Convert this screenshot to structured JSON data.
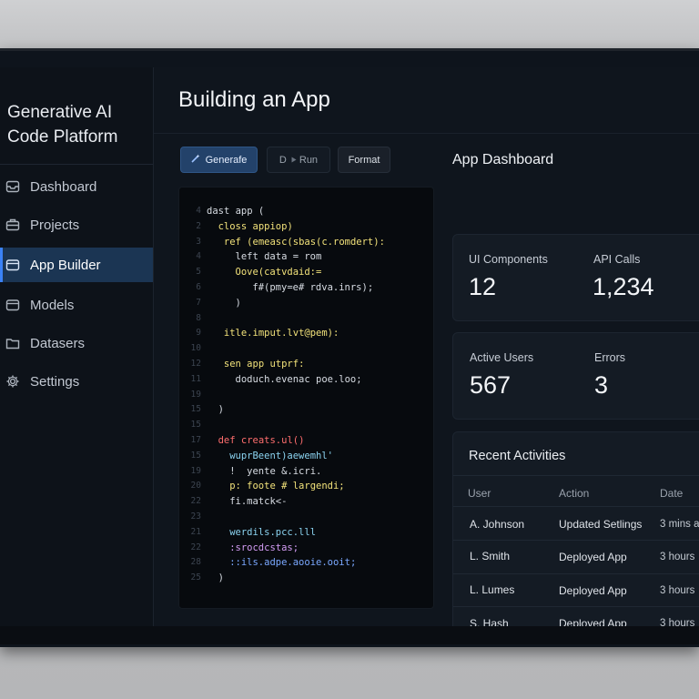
{
  "sidebar": {
    "brand_line1": "Generative AI",
    "brand_line2": "Code Platform",
    "items": [
      {
        "label": "Dashboard",
        "icon": "inbox-icon"
      },
      {
        "label": "Projects",
        "icon": "briefcase-icon"
      },
      {
        "label": "App Builder",
        "icon": "box-icon",
        "active": true
      },
      {
        "label": "Models",
        "icon": "box-icon"
      },
      {
        "label": "Datasers",
        "icon": "folder-icon"
      },
      {
        "label": "Settings",
        "icon": "gear-icon"
      }
    ]
  },
  "main": {
    "title": "Building an App",
    "toolbar": {
      "generate_label": "Generafe",
      "run_prefix": "D",
      "run_label": "Run",
      "format_label": "Format"
    },
    "editor": {
      "lines": [
        {
          "n": "4",
          "text": "dast app (",
          "color": "wht",
          "indent": 0
        },
        {
          "n": "2",
          "text": "closs appiop)",
          "color": "yel",
          "indent": 2
        },
        {
          "n": "3",
          "text": "ref (emeasc(sbas(c.romdert):",
          "color": "yel",
          "indent": 3
        },
        {
          "n": "4",
          "text": "left data = rom",
          "color": "wht",
          "indent": 5
        },
        {
          "n": "5",
          "text": "Oove(catvdaid:=",
          "color": "yel",
          "indent": 5
        },
        {
          "n": "6",
          "text": "f#(pmy=e# rdva.inrs);",
          "color": "wht",
          "indent": 8
        },
        {
          "n": "7",
          "text": ")",
          "color": "wht",
          "indent": 5
        },
        {
          "n": "8",
          "text": "",
          "color": "wht",
          "indent": 0
        },
        {
          "n": "9",
          "text": "itle.imput.lvt@pem):",
          "color": "yel",
          "indent": 3
        },
        {
          "n": "10",
          "text": "",
          "color": "wht",
          "indent": 0
        },
        {
          "n": "12",
          "text": "sen app utprf:",
          "color": "yel",
          "indent": 3
        },
        {
          "n": "11",
          "text": "doduch.evenac poe.loo;",
          "color": "wht",
          "indent": 5
        },
        {
          "n": "19",
          "text": "",
          "color": "wht",
          "indent": 0
        },
        {
          "n": "15",
          "text": ")",
          "color": "wht",
          "indent": 2
        },
        {
          "n": "15",
          "text": "",
          "color": "wht",
          "indent": 0
        },
        {
          "n": "17",
          "text": "def creats.ul()",
          "color": "red",
          "indent": 2
        },
        {
          "n": "15",
          "text": "wuprBeent)aewemhl'",
          "color": "cyn",
          "indent": 4
        },
        {
          "n": "19",
          "text": "!  yente &.icri.",
          "color": "wht",
          "indent": 4
        },
        {
          "n": "20",
          "text": "p: foote # largendi;",
          "color": "yel",
          "indent": 4
        },
        {
          "n": "22",
          "text": "fi.matck<-",
          "color": "wht",
          "indent": 4
        },
        {
          "n": "23",
          "text": "",
          "color": "wht",
          "indent": 0
        },
        {
          "n": "21",
          "text": "werdils.pcc.lll",
          "color": "cyn",
          "indent": 4
        },
        {
          "n": "22",
          "text": ":srocdcstas;",
          "color": "pur",
          "indent": 4
        },
        {
          "n": "28",
          "text": "::ils.adpe.aooie.ooit;",
          "color": "blu",
          "indent": 4
        },
        {
          "n": "25",
          "text": ")",
          "color": "wht",
          "indent": 2
        }
      ]
    },
    "dashboard": {
      "title": "App Dashboard",
      "stats": [
        {
          "label": "UI Components",
          "value": "12"
        },
        {
          "label": "API Calls",
          "value": "1,234"
        },
        {
          "label": "Active Users",
          "value": "567"
        },
        {
          "label": "Errors",
          "value": "3"
        }
      ],
      "activities": {
        "title": "Recent Activities",
        "columns": [
          "User",
          "Action",
          "Date"
        ],
        "rows": [
          {
            "user": "A. Johnson",
            "action": "Updated Setlings",
            "date": "3 mins a"
          },
          {
            "user": "L. Smith",
            "action": "Deployed App",
            "date": "3 hours"
          },
          {
            "user": "L. Lumes",
            "action": "Deployed App",
            "date": "3 hours"
          },
          {
            "user": "S. Hash",
            "action": "Deployed App",
            "date": "3 hours"
          }
        ]
      }
    }
  }
}
